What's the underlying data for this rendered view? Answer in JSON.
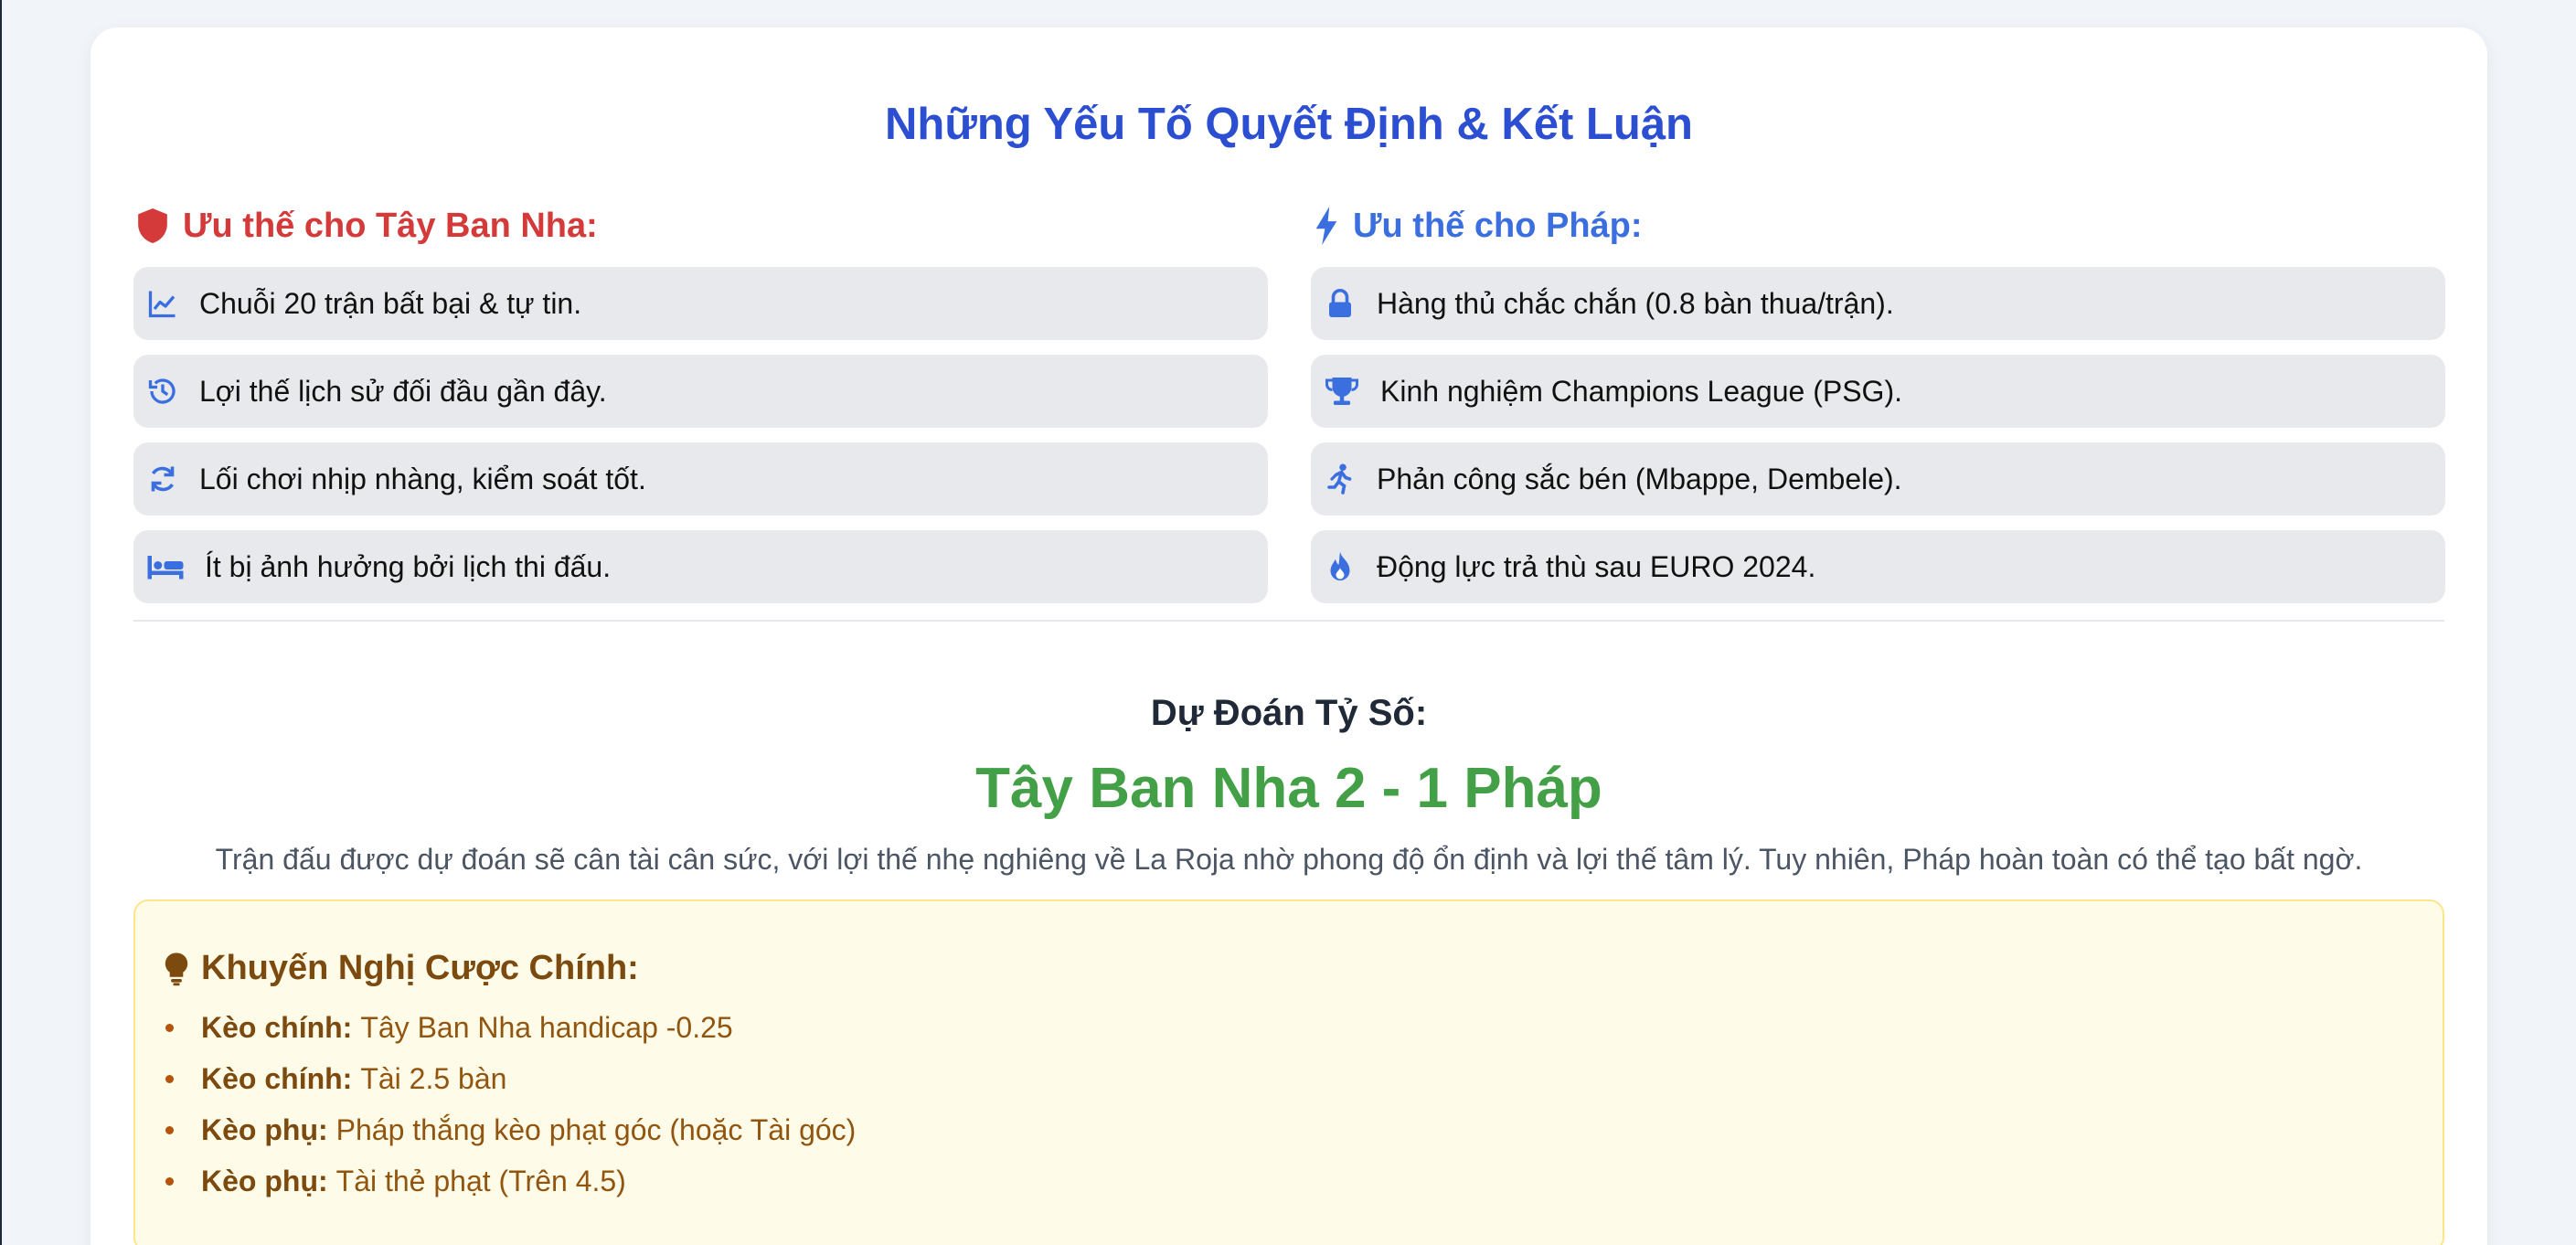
{
  "title": "Những Yếu Tố Quyết Định & Kết Luận",
  "spain": {
    "heading": "Ưu thế cho Tây Ban Nha:",
    "heading_icon": "shield-icon",
    "color": "#d43a3a",
    "items": [
      {
        "icon": "chart-line-icon",
        "text": "Chuỗi 20 trận bất bại & tự tin."
      },
      {
        "icon": "history-icon",
        "text": "Lợi thế lịch sử đối đầu gần đây."
      },
      {
        "icon": "refresh-icon",
        "text": "Lối chơi nhịp nhàng, kiểm soát tốt."
      },
      {
        "icon": "bed-icon",
        "text": "Ít bị ảnh hưởng bởi lịch thi đấu."
      }
    ]
  },
  "france": {
    "heading": "Ưu thế cho Pháp:",
    "heading_icon": "bolt-icon",
    "color": "#3b6fe0",
    "items": [
      {
        "icon": "lock-icon",
        "text": "Hàng thủ chắc chắn (0.8 bàn thua/trận)."
      },
      {
        "icon": "trophy-icon",
        "text": "Kinh nghiệm Champions League (PSG)."
      },
      {
        "icon": "running-icon",
        "text": "Phản công sắc bén (Mbappe, Dembele)."
      },
      {
        "icon": "fire-icon",
        "text": "Động lực trả thù sau EURO 2024."
      }
    ]
  },
  "prediction": {
    "label": "Dự Đoán Tỷ Số:",
    "score": "Tây Ban Nha 2 - 1 Pháp",
    "description": "Trận đấu được dự đoán sẽ cân tài cân sức, với lợi thế nhẹ nghiêng về La Roja nhờ phong độ ổn định và lợi thế tâm lý. Tuy nhiên, Pháp hoàn toàn có thể tạo bất ngờ."
  },
  "bets": {
    "heading": "Khuyến Nghị Cược Chính:",
    "heading_icon": "lightbulb-icon",
    "items": [
      {
        "key": "Kèo chính:",
        "value": "Tây Ban Nha handicap -0.25"
      },
      {
        "key": "Kèo chính:",
        "value": "Tài 2.5 bàn"
      },
      {
        "key": "Kèo phụ:",
        "value": "Pháp thắng kèo phạt góc (hoặc Tài góc)"
      },
      {
        "key": "Kèo phụ:",
        "value": "Tài thẻ phạt (Trên 4.5)"
      }
    ]
  }
}
